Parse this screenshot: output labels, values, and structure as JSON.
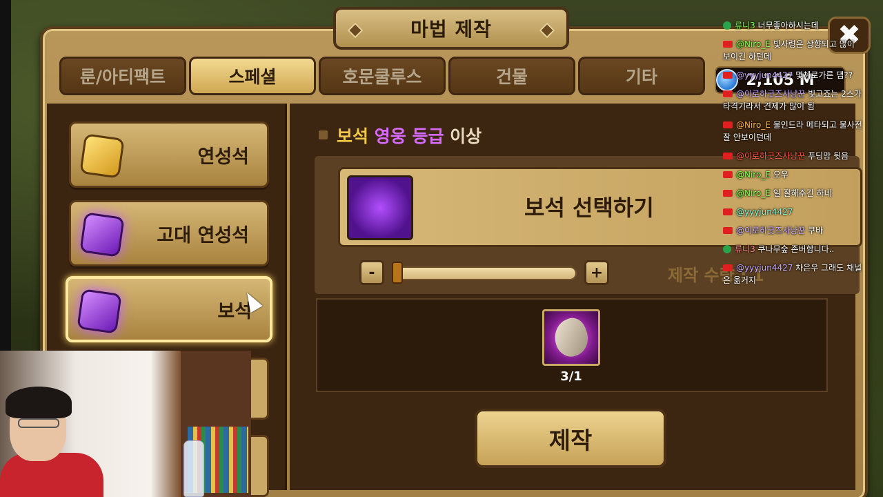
{
  "window": {
    "title": "마법 제작",
    "close_icon": "✖"
  },
  "tabs": [
    {
      "label": "룬/아티팩트",
      "active": false
    },
    {
      "label": "스페셜",
      "active": true
    },
    {
      "label": "호문쿨루스",
      "active": false
    },
    {
      "label": "건물",
      "active": false
    },
    {
      "label": "기타",
      "active": false
    }
  ],
  "currency": {
    "value": "2,105 M",
    "icon": "crystal-icon"
  },
  "side_items": [
    {
      "label": "연성석",
      "icon": "gold-rune-stone-icon"
    },
    {
      "label": "고대 연성석",
      "icon": "purple-rune-stone-icon"
    },
    {
      "label": "보석",
      "icon": "gem-icon",
      "active": true
    }
  ],
  "heading": {
    "w1": "보석",
    "w2": "영웅 등급",
    "w3": "이상"
  },
  "selector": {
    "label": "보석 선택하기",
    "icon": "gem-crystal-icon"
  },
  "quantity": {
    "minus": "-",
    "plus": "+",
    "text": "제작 수량 : 1",
    "value_fraction": 0
  },
  "material": {
    "count": "3/1",
    "icon": "claw-icon"
  },
  "make_button": {
    "label": "제작"
  },
  "chat": [
    {
      "src": "tw",
      "user": "류니3",
      "ucls": "u-green",
      "text": "너무좋아하시는데"
    },
    {
      "src": "yt",
      "user": "@Niro_E",
      "ucls": "u-green",
      "text": "빛사령은 상향되고 많이 보이긴 하던데"
    },
    {
      "src": "yt",
      "user": "@yyyjun4427",
      "ucls": "u-purple",
      "text": "몇쳬로가른 댐??"
    },
    {
      "src": "yt",
      "user": "@이로하굿즈사냥꾼",
      "ucls": "u-purple",
      "text": "빛고죠는 2스가 타격기라서 견제가 많이 됨"
    },
    {
      "src": "yt",
      "user": "@Niro_E",
      "ucls": "u-orange",
      "text": "불인드라 메타되고 불사전 잘 안보이던데"
    },
    {
      "src": "yt",
      "user": "@이로하굿즈사냥꾼",
      "ucls": "u-red",
      "text": "푸딩맘 뒷음"
    },
    {
      "src": "yt",
      "user": "@Niro_E",
      "ucls": "u-green",
      "text": "오우"
    },
    {
      "src": "yt",
      "user": "@Niro_E",
      "ucls": "u-green",
      "text": "일 잘해주긴 하네"
    },
    {
      "src": "yt",
      "user": "@yyyjun4427",
      "ucls": "u-teal",
      "text": ""
    },
    {
      "src": "yt",
      "user": "@이로하굿즈사냥꾼",
      "ucls": "u-purple",
      "text": "쿠바"
    },
    {
      "src": "tw",
      "user": "류니3",
      "ucls": "u-pink",
      "text": "쿠나무숲 존버합니다.."
    },
    {
      "src": "yt",
      "user": "@yyyjun4427",
      "ucls": "u-purple",
      "text": "차은우 그래도 채널은 옮거지"
    }
  ],
  "colors": {
    "accent_gold": "#f2c84a",
    "hero_grade_purple": "#d86bff",
    "panel_brown": "#3d2611"
  }
}
